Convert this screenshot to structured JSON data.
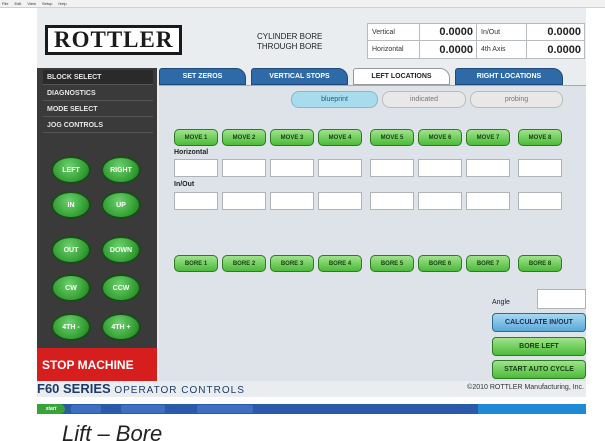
{
  "menubar": {
    "items": [
      "File",
      "Edit",
      "View",
      "Setup",
      "Help"
    ]
  },
  "logo": {
    "text": "ROTTLER"
  },
  "bore": {
    "cylinder": "CYLINDER BORE",
    "through": "THROUGH BORE"
  },
  "readouts": {
    "vertical_label": "Vertical",
    "vertical_value": "0.0000",
    "inout_label": "In/Out",
    "inout_value": "0.0000",
    "horizontal_label": "Horizontal",
    "horizontal_value": "0.0000",
    "fourth_axis_label": "4th Axis",
    "fourth_axis_value": "0.0000"
  },
  "sidebar": {
    "items": [
      "BLOCK SELECT",
      "DIAGNOSTICS",
      "MODE SELECT",
      "JOG CONTROLS"
    ],
    "jog": [
      "LEFT",
      "RIGHT",
      "IN",
      "UP",
      "OUT",
      "DOWN",
      "CW",
      "CCW",
      "4TH -",
      "4TH +"
    ],
    "stop": "STOP MACHINE"
  },
  "tabs": [
    "SET ZEROS",
    "VERTICAL STOPS",
    "LEFT LOCATIONS",
    "RIGHT LOCATIONS"
  ],
  "indicators": [
    "blueprint",
    "indicated",
    "probing"
  ],
  "moves": [
    "MOVE 1",
    "MOVE 2",
    "MOVE 3",
    "MOVE 4",
    "MOVE 5",
    "MOVE 6",
    "MOVE 7",
    "MOVE 8"
  ],
  "bores": [
    "BORE 1",
    "BORE 2",
    "BORE 3",
    "BORE 4",
    "BORE 5",
    "BORE 6",
    "BORE 7",
    "BORE 8"
  ],
  "labels": {
    "horizontal": "Horizontal",
    "inout": "In/Out",
    "angle": "Angle"
  },
  "actions": {
    "calculate": "CALCULATE IN/OUT",
    "bore_left": "BORE LEFT",
    "start": "START AUTO CYCLE"
  },
  "footer": {
    "series": "F60 SERIES",
    "controls": "OPERATOR CONTROLS",
    "copyright": "©2010 ROTTLER Manufacturing, Inc."
  },
  "taskbar": {
    "start": "start"
  },
  "caption": "Lift – Bore",
  "colors": {
    "accent_blue": "#2e6aa8",
    "accent_green": "#4cbb3a",
    "stop_red": "#d61e1e",
    "sidebar_dark": "#3a3a3a"
  }
}
